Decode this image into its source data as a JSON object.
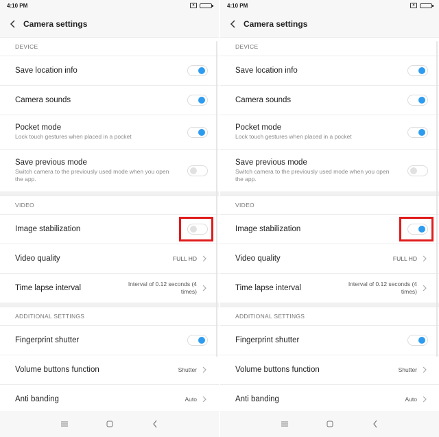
{
  "status": {
    "time": "4:10 PM",
    "sim": "×"
  },
  "appbar": {
    "title": "Camera settings"
  },
  "sections": {
    "device": "DEVICE",
    "video": "VIDEO",
    "additional": "ADDITIONAL SETTINGS"
  },
  "rows": {
    "save_location": {
      "label": "Save location info"
    },
    "camera_sounds": {
      "label": "Camera sounds"
    },
    "pocket_mode": {
      "label": "Pocket mode",
      "sub": "Lock touch gestures when placed in a pocket"
    },
    "save_prev": {
      "label": "Save previous mode",
      "sub": "Switch camera to the previously used mode when you open the app."
    },
    "image_stab": {
      "label": "Image stabilization"
    },
    "video_quality": {
      "label": "Video quality",
      "value": "FULL HD"
    },
    "time_lapse": {
      "label": "Time lapse interval",
      "value": "Interval of 0.12 seconds (4 times)"
    },
    "fingerprint": {
      "label": "Fingerprint shutter"
    },
    "volume_buttons": {
      "label": "Volume buttons function",
      "value": "Shutter"
    },
    "anti_banding": {
      "label": "Anti banding",
      "value": "Auto"
    }
  },
  "states": {
    "left": {
      "save_location": true,
      "camera_sounds": true,
      "pocket_mode": true,
      "save_prev": false,
      "image_stab": false,
      "fingerprint": true
    },
    "right": {
      "save_location": true,
      "camera_sounds": true,
      "pocket_mode": true,
      "save_prev": false,
      "image_stab": true,
      "fingerprint": true
    }
  },
  "colors": {
    "toggle_on": "#2d9cf0",
    "highlight": "#e01b1b"
  },
  "icons": {
    "back": "chevron-left-icon",
    "chevron": "chevron-right-icon",
    "menu": "menu-icon",
    "home": "home-icon",
    "nav_back": "nav-back-icon"
  }
}
